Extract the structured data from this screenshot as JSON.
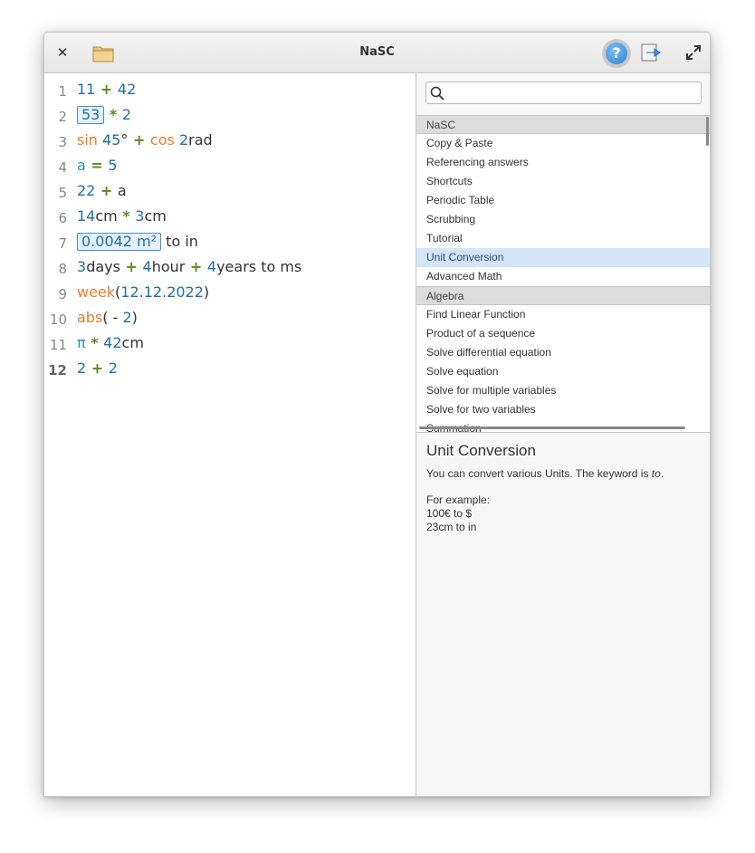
{
  "app": {
    "title": "NaSC"
  },
  "editor": {
    "lines": [
      {
        "num": "1",
        "tokens": [
          {
            "t": "11",
            "c": "n"
          },
          {
            "t": " + ",
            "c": "op"
          },
          {
            "t": "42",
            "c": "n"
          }
        ]
      },
      {
        "num": "2",
        "tokens": [
          {
            "t": "53",
            "c": "res"
          },
          {
            "t": " * ",
            "c": "op"
          },
          {
            "t": "2",
            "c": "n"
          }
        ]
      },
      {
        "num": "3",
        "tokens": [
          {
            "t": "sin ",
            "c": "fn"
          },
          {
            "t": "45",
            "c": "n"
          },
          {
            "t": "°",
            "c": "u"
          },
          {
            "t": " + ",
            "c": "op"
          },
          {
            "t": "cos ",
            "c": "fn"
          },
          {
            "t": "2",
            "c": "n"
          },
          {
            "t": "rad",
            "c": "u"
          }
        ]
      },
      {
        "num": "4",
        "tokens": [
          {
            "t": "a",
            "c": "var"
          },
          {
            "t": " = ",
            "c": "op"
          },
          {
            "t": "5",
            "c": "n"
          }
        ]
      },
      {
        "num": "5",
        "tokens": [
          {
            "t": "22",
            "c": "n"
          },
          {
            "t": " + ",
            "c": "op"
          },
          {
            "t": "a",
            "c": "u"
          }
        ]
      },
      {
        "num": "6",
        "tokens": [
          {
            "t": "14",
            "c": "n"
          },
          {
            "t": "cm",
            "c": "u"
          },
          {
            "t": " * ",
            "c": "op"
          },
          {
            "t": "3",
            "c": "n"
          },
          {
            "t": "cm",
            "c": "u"
          }
        ]
      },
      {
        "num": "7",
        "tokens": [
          {
            "t": "0.0042 m²",
            "c": "res"
          },
          {
            "t": " to in",
            "c": "u"
          }
        ]
      },
      {
        "num": "8",
        "tokens": [
          {
            "t": "3",
            "c": "n"
          },
          {
            "t": "days",
            "c": "u"
          },
          {
            "t": " + ",
            "c": "op"
          },
          {
            "t": "4",
            "c": "n"
          },
          {
            "t": "hour",
            "c": "u"
          },
          {
            "t": " + ",
            "c": "op"
          },
          {
            "t": "4",
            "c": "n"
          },
          {
            "t": "years to ms",
            "c": "u"
          }
        ]
      },
      {
        "num": "9",
        "tokens": [
          {
            "t": "week",
            "c": "fn"
          },
          {
            "t": "(",
            "c": "u"
          },
          {
            "t": "12.12.2022",
            "c": "n"
          },
          {
            "t": ")",
            "c": "u"
          }
        ]
      },
      {
        "num": "10",
        "tokens": [
          {
            "t": "abs",
            "c": "fn"
          },
          {
            "t": "( - ",
            "c": "u"
          },
          {
            "t": "2",
            "c": "n"
          },
          {
            "t": ")",
            "c": "u"
          }
        ]
      },
      {
        "num": "11",
        "tokens": [
          {
            "t": "π",
            "c": "var"
          },
          {
            "t": " * ",
            "c": "op"
          },
          {
            "t": "42",
            "c": "n"
          },
          {
            "t": "cm",
            "c": "u"
          }
        ]
      },
      {
        "num": "12",
        "current": true,
        "tokens": [
          {
            "t": "2",
            "c": "n"
          },
          {
            "t": " + ",
            "c": "op"
          },
          {
            "t": "2",
            "c": "n"
          }
        ]
      }
    ]
  },
  "help": {
    "search_placeholder": "",
    "list": [
      {
        "label": "NaSC",
        "header": true
      },
      {
        "label": "Copy & Paste"
      },
      {
        "label": "Referencing answers"
      },
      {
        "label": "Shortcuts"
      },
      {
        "label": "Periodic Table"
      },
      {
        "label": "Scrubbing"
      },
      {
        "label": "Tutorial"
      },
      {
        "label": "Unit Conversion",
        "selected": true
      },
      {
        "label": "Advanced Math"
      },
      {
        "label": "Algebra",
        "header": true
      },
      {
        "label": "Find Linear Function"
      },
      {
        "label": "Product of a sequence"
      },
      {
        "label": "Solve differential equation"
      },
      {
        "label": "Solve equation"
      },
      {
        "label": "Solve for multiple variables"
      },
      {
        "label": "Solve for two variables"
      },
      {
        "label": "Summation"
      }
    ],
    "detail": {
      "title": "Unit Conversion",
      "intro": "You can convert various Units. The keyword is ",
      "keyword": "to",
      "intro_end": ".",
      "example_label": "For example:",
      "example_1": "100€ to $",
      "example_2": "23cm to in"
    }
  },
  "icons": {
    "close": "close-icon",
    "folder": "folder-icon",
    "help": "help-icon",
    "export": "export-icon",
    "maximize": "maximize-icon",
    "search": "search-icon"
  },
  "colors": {
    "number": "#1f6fa8",
    "function": "#ef7b2a",
    "operator": "#5a8a1e",
    "variable": "#2a8fc7",
    "selection": "#d4e5f7"
  }
}
